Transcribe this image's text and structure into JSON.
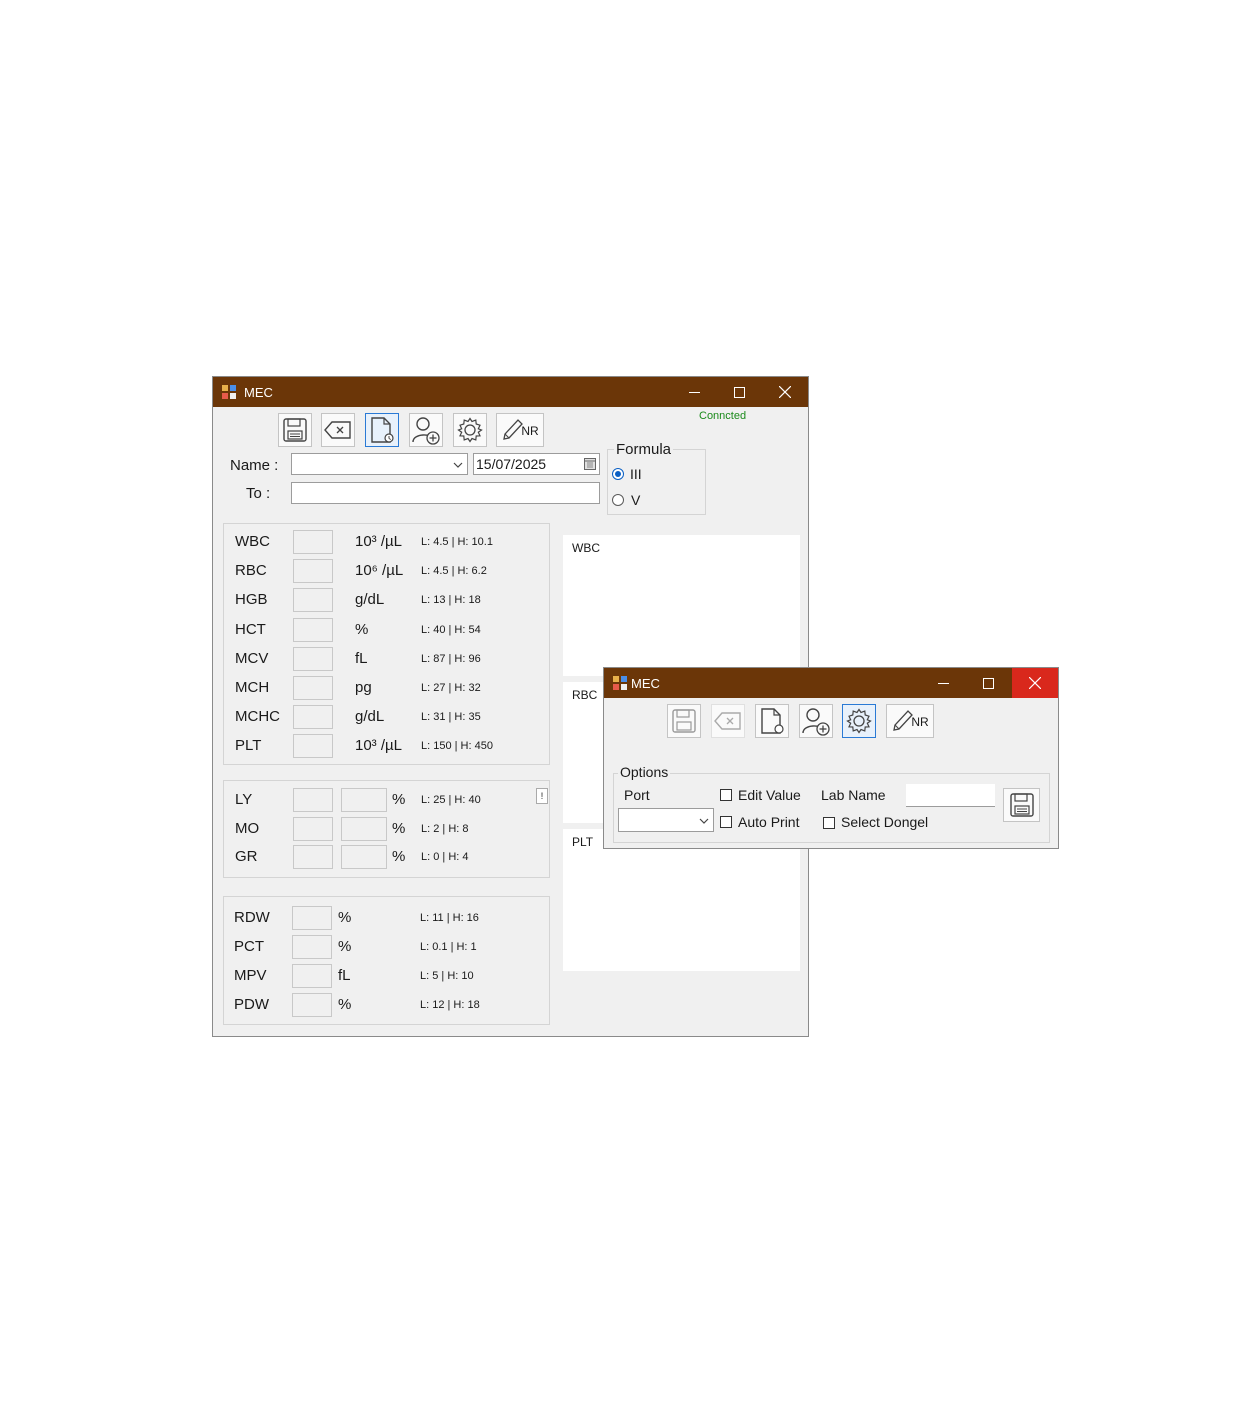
{
  "main_window": {
    "title": "MEC",
    "status": "Conncted",
    "status_color": "#1a8a1a",
    "toolbar": [
      "save-icon",
      "clear-icon",
      "report-icon",
      "add-patient-icon",
      "settings-icon",
      "normal-range-edit-icon"
    ],
    "toolbar_nr_text": "NR",
    "name_label": "Name :",
    "name_value": "",
    "date_value": "15/07/2025",
    "to_label": "To  :",
    "to_value": "",
    "formula": {
      "legend": "Formula",
      "options": [
        "III",
        "V"
      ],
      "selected": "III"
    },
    "params_main": [
      {
        "name": "WBC",
        "unit": "10³ /µL",
        "range": "L: 4.5 | H: 10.1"
      },
      {
        "name": "RBC",
        "unit": "10⁶ /µL",
        "range": "L: 4.5 | H: 6.2"
      },
      {
        "name": "HGB",
        "unit": "g/dL",
        "range": "L: 13 | H: 18"
      },
      {
        "name": "HCT",
        "unit": "%",
        "range": "L: 40 | H: 54"
      },
      {
        "name": "MCV",
        "unit": "fL",
        "range": "L: 87 | H: 96"
      },
      {
        "name": "MCH",
        "unit": "pg",
        "range": "L: 27 | H: 32"
      },
      {
        "name": "MCHC",
        "unit": "g/dL",
        "range": "L: 31 | H: 35"
      },
      {
        "name": "PLT",
        "unit": "10³ /µL",
        "range": "L: 150 | H: 450"
      }
    ],
    "params_diff": [
      {
        "name": "LY",
        "unit": "%",
        "range": "L: 25 | H: 40"
      },
      {
        "name": "MO",
        "unit": "%",
        "range": "L: 2 | H: 8"
      },
      {
        "name": "GR",
        "unit": "%",
        "range": "L: 0 | H: 4"
      }
    ],
    "diff_toggle_label": "!",
    "params_extra": [
      {
        "name": "RDW",
        "unit": "%",
        "range": "L: 11 | H: 16"
      },
      {
        "name": "PCT",
        "unit": "%",
        "range": "L: 0.1 | H: 1"
      },
      {
        "name": "MPV",
        "unit": "fL",
        "range": "L: 5 | H: 10"
      },
      {
        "name": "PDW",
        "unit": "%",
        "range": "L: 12 | H: 18"
      }
    ],
    "graphs": [
      "WBC",
      "RBC",
      "PLT"
    ]
  },
  "settings_window": {
    "title": "MEC",
    "options_legend": "Options",
    "port_label": "Port",
    "port_value": "",
    "edit_value_label": "Edit Value",
    "edit_value_checked": false,
    "auto_print_label": "Auto Print",
    "auto_print_checked": false,
    "lab_name_label": "Lab Name",
    "lab_name_value": "",
    "select_dongle_label": "Select Dongel",
    "select_dongle_checked": false,
    "toolbar_nr_text": "NR"
  },
  "colors": {
    "titlebar": "#6b3608",
    "close_hover": "#d9281c",
    "window_bg": "#f0f0f0"
  }
}
